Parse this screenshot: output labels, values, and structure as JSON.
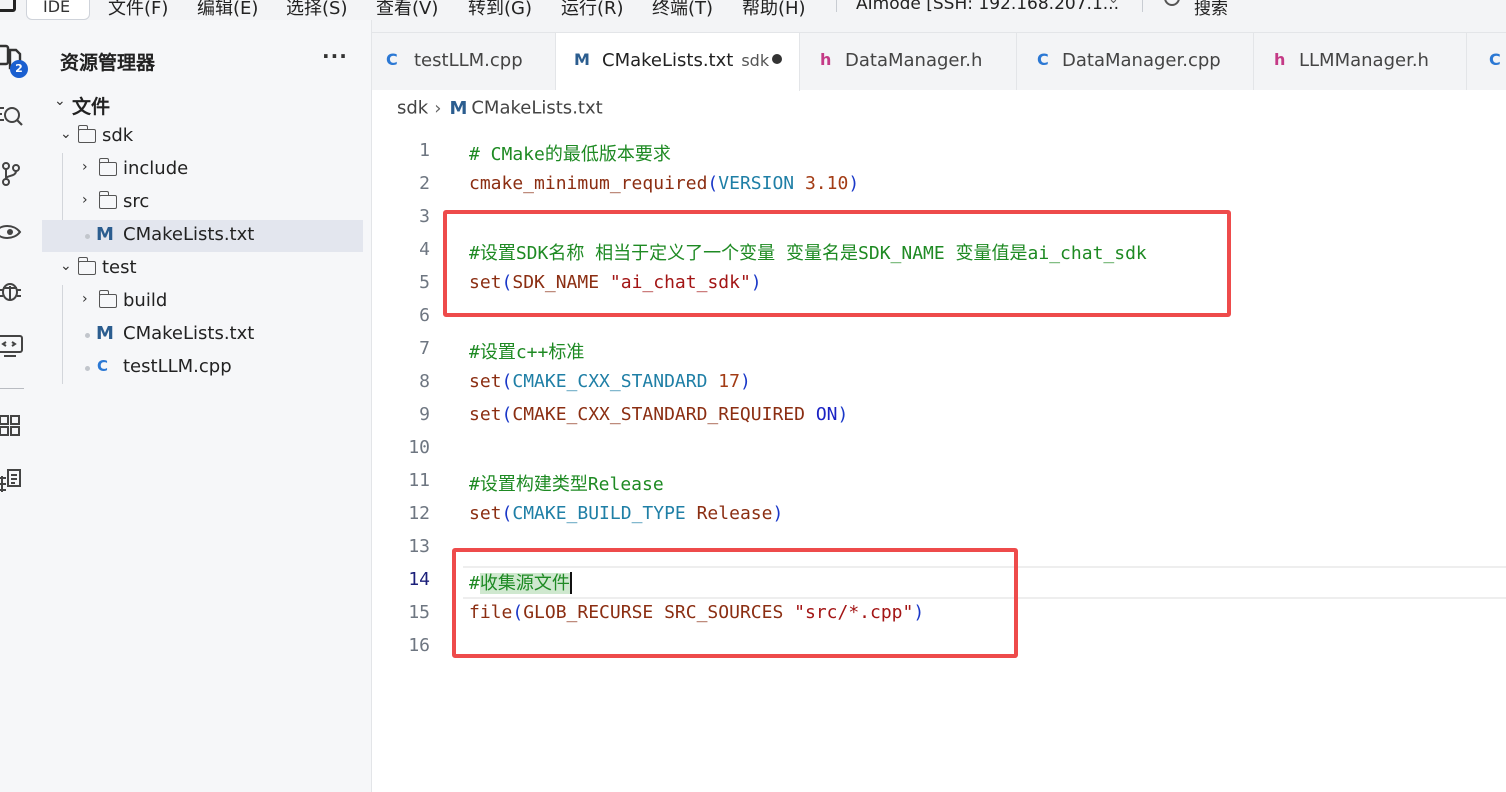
{
  "menubar": {
    "ide_label": "IDE",
    "items": [
      "文件(F)",
      "编辑(E)",
      "选择(S)",
      "查看(V)",
      "转到(G)",
      "运行(R)",
      "终端(T)",
      "帮助(H)"
    ],
    "remote": "AImode [SSH: 192.168.207.1...",
    "search": "搜索"
  },
  "activity": {
    "explorer_badge": "2"
  },
  "explorer": {
    "title": "资源管理器",
    "more": "···",
    "root": "文件",
    "items": [
      {
        "label": "sdk",
        "type": "folder",
        "expanded": true
      },
      {
        "label": "include",
        "type": "folder",
        "expanded": false
      },
      {
        "label": "src",
        "type": "folder",
        "expanded": false
      },
      {
        "label": "CMakeLists.txt",
        "type": "cmake",
        "selected": true
      },
      {
        "label": "test",
        "type": "folder",
        "expanded": true
      },
      {
        "label": "build",
        "type": "folder",
        "expanded": false
      },
      {
        "label": "CMakeLists.txt",
        "type": "cmake"
      },
      {
        "label": "testLLM.cpp",
        "type": "cpp"
      }
    ]
  },
  "tabs": [
    {
      "label": "testLLM.cpp",
      "icon": "C",
      "kind": "cpp"
    },
    {
      "label": "CMakeLists.txt",
      "sub": "sdk",
      "icon": "M",
      "kind": "cmake",
      "active": true,
      "modified": true
    },
    {
      "label": "DataManager.h",
      "icon": "h",
      "kind": "header"
    },
    {
      "label": "DataManager.cpp",
      "icon": "C",
      "kind": "cpp"
    },
    {
      "label": "LLMManager.h",
      "icon": "h",
      "kind": "header"
    },
    {
      "label": "",
      "icon": "C",
      "kind": "cpp"
    }
  ],
  "breadcrumb": {
    "folder": "sdk",
    "file": "CMakeLists.txt"
  },
  "editor": {
    "current_line": 14,
    "lines": [
      {
        "n": "1",
        "parts": [
          [
            "cm",
            "# CMake的最低版本要求"
          ]
        ]
      },
      {
        "n": "2",
        "parts": [
          [
            "kw",
            "cmake_minimum_required"
          ],
          [
            "p",
            "("
          ],
          [
            "var",
            "VERSION"
          ],
          [
            "t",
            " "
          ],
          [
            "num",
            "3.10"
          ],
          [
            "p",
            ")"
          ]
        ]
      },
      {
        "n": "3",
        "parts": []
      },
      {
        "n": "4",
        "parts": [
          [
            "cm",
            "#设置SDK名称 相当于定义了一个变量 变量名是SDK_NAME 变量值是ai_chat_sdk"
          ]
        ]
      },
      {
        "n": "5",
        "parts": [
          [
            "kw",
            "set"
          ],
          [
            "p",
            "("
          ],
          [
            "kw",
            "SDK_NAME"
          ],
          [
            "t",
            " "
          ],
          [
            "str",
            "\"ai_chat_sdk\""
          ],
          [
            "p",
            ")"
          ]
        ]
      },
      {
        "n": "6",
        "parts": []
      },
      {
        "n": "7",
        "parts": [
          [
            "cm",
            "#设置c++标准"
          ]
        ]
      },
      {
        "n": "8",
        "parts": [
          [
            "kw",
            "set"
          ],
          [
            "p",
            "("
          ],
          [
            "var",
            "CMAKE_CXX_STANDARD"
          ],
          [
            "t",
            " "
          ],
          [
            "num",
            "17"
          ],
          [
            "p",
            ")"
          ]
        ]
      },
      {
        "n": "9",
        "parts": [
          [
            "kw",
            "set"
          ],
          [
            "p",
            "("
          ],
          [
            "kw",
            "CMAKE_CXX_STANDARD_REQUIRED"
          ],
          [
            "t",
            " "
          ],
          [
            "on",
            "ON"
          ],
          [
            "p",
            ")"
          ]
        ]
      },
      {
        "n": "10",
        "parts": []
      },
      {
        "n": "11",
        "parts": [
          [
            "cm",
            "#设置构建类型Release"
          ]
        ]
      },
      {
        "n": "12",
        "parts": [
          [
            "kw",
            "set"
          ],
          [
            "p",
            "("
          ],
          [
            "var",
            "CMAKE_BUILD_TYPE"
          ],
          [
            "t",
            " "
          ],
          [
            "kw",
            "Release"
          ],
          [
            "p",
            ")"
          ]
        ]
      },
      {
        "n": "13",
        "parts": []
      },
      {
        "n": "14",
        "parts": [
          [
            "cm",
            "#"
          ],
          [
            "cmsel",
            "收集源文件"
          ],
          [
            "cursor",
            ""
          ]
        ]
      },
      {
        "n": "15",
        "parts": [
          [
            "kw",
            "file"
          ],
          [
            "p",
            "("
          ],
          [
            "kw",
            "GLOB_RECURSE SRC_SOURCES"
          ],
          [
            "t",
            " "
          ],
          [
            "str",
            "\"src/*.cpp\""
          ],
          [
            "p",
            ")"
          ]
        ]
      },
      {
        "n": "16",
        "parts": []
      }
    ]
  },
  "colors": {
    "annotation": "#ee4b4b",
    "accent": "#1a5fd0"
  }
}
